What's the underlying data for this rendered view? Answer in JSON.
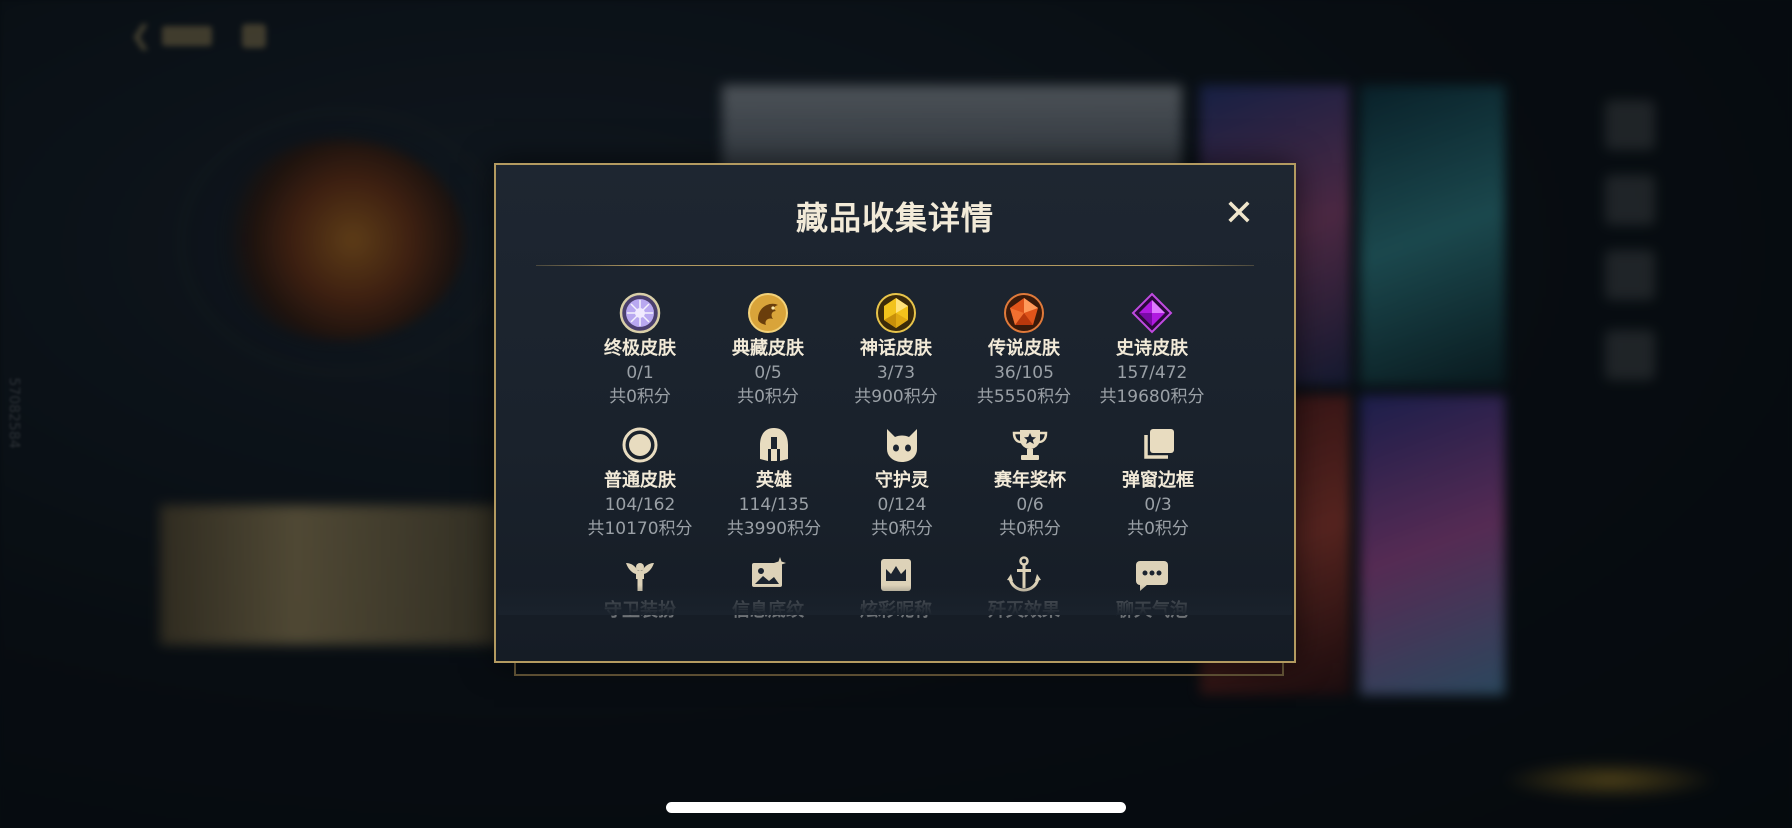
{
  "modal": {
    "title": "藏品收集详情",
    "close_glyph": "✕"
  },
  "categories": [
    {
      "name": "终极皮肤",
      "count": "0/1",
      "points": "共0积分",
      "icon": "ultimate-gem-icon"
    },
    {
      "name": "典藏皮肤",
      "count": "0/5",
      "points": "共0积分",
      "icon": "dragon-icon"
    },
    {
      "name": "神话皮肤",
      "count": "3/73",
      "points": "共900积分",
      "icon": "mythic-gem-icon"
    },
    {
      "name": "传说皮肤",
      "count": "36/105",
      "points": "共5550积分",
      "icon": "legendary-gem-icon"
    },
    {
      "name": "史诗皮肤",
      "count": "157/472",
      "points": "共19680积分",
      "icon": "epic-gem-icon"
    },
    {
      "name": "普通皮肤",
      "count": "104/162",
      "points": "共10170积分",
      "icon": "circle-icon"
    },
    {
      "name": "英雄",
      "count": "114/135",
      "points": "共3990积分",
      "icon": "helmet-icon"
    },
    {
      "name": "守护灵",
      "count": "0/124",
      "points": "共0积分",
      "icon": "guardian-icon"
    },
    {
      "name": "赛年奖杯",
      "count": "0/6",
      "points": "共0积分",
      "icon": "trophy-icon"
    },
    {
      "name": "弹窗边框",
      "count": "0/3",
      "points": "共0积分",
      "icon": "frames-icon"
    },
    {
      "name": "守卫装扮",
      "icon": "ward-icon"
    },
    {
      "name": "信息底纹",
      "icon": "banner-icon"
    },
    {
      "name": "炫彩昵称",
      "icon": "crown-card-icon"
    },
    {
      "name": "歼灭效果",
      "icon": "anchor-icon"
    },
    {
      "name": "聊天气泡",
      "icon": "chat-bubble-icon"
    }
  ],
  "side_text": "57082584",
  "colors": {
    "modal_border": "#b39a60",
    "title": "#f2ead8",
    "muted": "#9aa0a6"
  }
}
